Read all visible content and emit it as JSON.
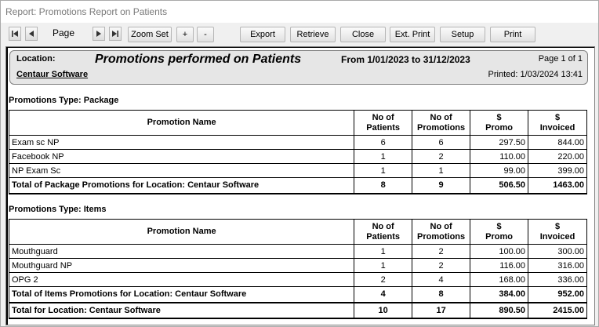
{
  "window": {
    "title": "Report: Promotions Report on Patients"
  },
  "toolbar": {
    "page_label": "Page",
    "zoom_set": "Zoom Set",
    "zoom_in": "+",
    "zoom_out": "-",
    "export": "Export",
    "retrieve": "Retrieve",
    "close": "Close",
    "ext_print": "Ext. Print",
    "setup": "Setup",
    "print": "Print"
  },
  "report": {
    "location_label": "Location:",
    "title": "Promotions performed on Patients",
    "date_range": "From 1/01/2023 to 31/12/2023",
    "page_info": "Page 1 of 1",
    "location": "Centaur Software",
    "printed": "Printed: 1/03/2024 13:41",
    "columns": {
      "name": "Promotion Name",
      "patients_1": "No of",
      "patients_2": "Patients",
      "promotions_1": "No of",
      "promotions_2": "Promotions",
      "promo_1": "$",
      "promo_2": "Promo",
      "invoiced_1": "$",
      "invoiced_2": "Invoiced"
    },
    "package": {
      "section_title": "Promotions Type: Package",
      "rows": [
        {
          "name": "Exam sc NP",
          "patients": "6",
          "promotions": "6",
          "promo": "297.50",
          "invoiced": "844.00"
        },
        {
          "name": "Facebook NP",
          "patients": "1",
          "promotions": "2",
          "promo": "110.00",
          "invoiced": "220.00"
        },
        {
          "name": "NP Exam Sc",
          "patients": "1",
          "promotions": "1",
          "promo": "99.00",
          "invoiced": "399.00"
        }
      ],
      "total": {
        "name": "Total of Package Promotions for Location: Centaur Software",
        "patients": "8",
        "promotions": "9",
        "promo": "506.50",
        "invoiced": "1463.00"
      }
    },
    "items": {
      "section_title": "Promotions Type: Items",
      "rows": [
        {
          "name": "Mouthguard",
          "patients": "1",
          "promotions": "2",
          "promo": "100.00",
          "invoiced": "300.00"
        },
        {
          "name": "Mouthguard NP",
          "patients": "1",
          "promotions": "2",
          "promo": "116.00",
          "invoiced": "316.00"
        },
        {
          "name": "OPG 2",
          "patients": "2",
          "promotions": "4",
          "promo": "168.00",
          "invoiced": "336.00"
        }
      ],
      "total": {
        "name": "Total of Items Promotions for Location: Centaur Software",
        "patients": "4",
        "promotions": "8",
        "promo": "384.00",
        "invoiced": "952.00"
      }
    },
    "grand_total": {
      "name": "Total for Location: Centaur Software",
      "patients": "10",
      "promotions": "17",
      "promo": "890.50",
      "invoiced": "2415.00"
    }
  }
}
